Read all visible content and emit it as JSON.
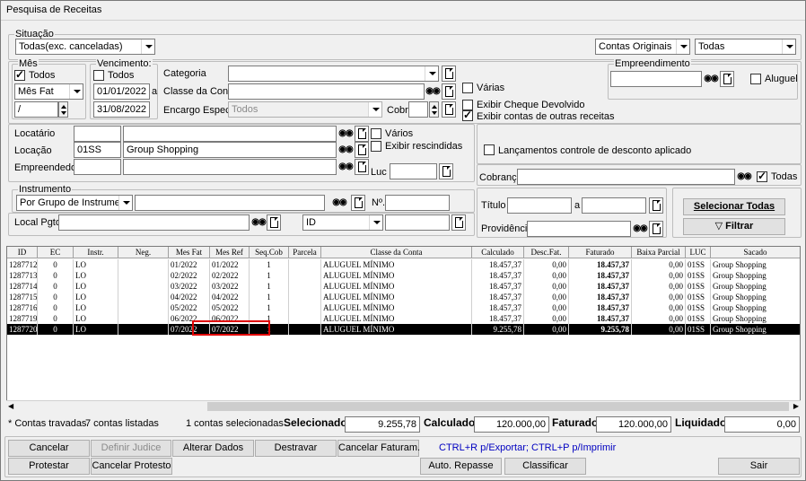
{
  "window": {
    "title": "Pesquisa de Receitas"
  },
  "situacao": {
    "label": "Situação",
    "value": "Todas(exc. canceladas)"
  },
  "top_right": {
    "contas": "Contas Originais",
    "todas": "Todas"
  },
  "mes": {
    "label": "Mês",
    "todos": "Todos",
    "todos_checked": true,
    "tipo": "Mês Fat",
    "valor": "/"
  },
  "vencimento": {
    "label": "Vencimento:",
    "todos": "Todos",
    "todos_checked": false,
    "de": "01/01/2022",
    "a_label": "a",
    "ate": "31/08/2022"
  },
  "categoria": {
    "label": "Categoria",
    "value": ""
  },
  "classe_conta": {
    "label": "Classe da Conta",
    "value": ""
  },
  "encargo": {
    "label": "Encargo Espec.",
    "value": "Todos"
  },
  "cobr": {
    "label": "Cobr",
    "value": ""
  },
  "options": {
    "varias": "Várias",
    "varias_checked": false,
    "cheque": "Exibir Cheque Devolvido",
    "cheque_checked": false,
    "outras": "Exibir contas de outras receitas",
    "outras_checked": true
  },
  "empreendimento": {
    "label": "Empreendimento",
    "value": "",
    "aluguel": "Aluguel",
    "aluguel_checked": false
  },
  "locatario": {
    "label": "Locatário",
    "code": "",
    "name": ""
  },
  "locacao": {
    "label": "Locação",
    "code": "01SS",
    "name": "Group Shopping"
  },
  "empreendedor": {
    "label": "Empreendedor",
    "code": "",
    "name": ""
  },
  "flags": {
    "varios": "Vários",
    "rescindidas": "Exibir rescindidas"
  },
  "luc": {
    "label": "Luc",
    "value": ""
  },
  "desconto": {
    "label": "Lançamentos controle de desconto aplicado",
    "checked": false
  },
  "cobranca": {
    "label": "Cobrança",
    "value": "",
    "todas": "Todas",
    "todas_checked": true
  },
  "instrumento": {
    "label": "Instrumento",
    "tipo": "Por Grupo de Instrumento",
    "value": "",
    "n_label": "Nº.",
    "n_value": ""
  },
  "local_pgto": {
    "label": "Local Pgto",
    "value": "",
    "id": "ID",
    "id_value": ""
  },
  "titulo": {
    "label": "Título",
    "de": "",
    "a_label": "a",
    "ate": ""
  },
  "providencia": {
    "label": "Providência",
    "value": ""
  },
  "buttons_right": {
    "selecionar": "Selecionar Todas",
    "filtrar": "Filtrar"
  },
  "grid": {
    "headers": [
      "ID",
      "EC",
      "Instr.",
      "Neg.",
      "Mes Fat",
      "Mes Ref",
      "Seq.Cob",
      "Parcela",
      "Classe da Conta",
      "Calculado",
      "Desc.Fat.",
      "Faturado",
      "Baixa Parcial",
      "LUC",
      "Sacado"
    ],
    "rows": [
      [
        "1287712",
        "0",
        "LO",
        "",
        "01/2022",
        "01/2022",
        "1",
        "",
        "ALUGUEL MÍNIMO",
        "18.457,37",
        "0,00",
        "18.457,37",
        "0,00",
        "01SS",
        "Group Shopping"
      ],
      [
        "1287713",
        "0",
        "LO",
        "",
        "02/2022",
        "02/2022",
        "1",
        "",
        "ALUGUEL MÍNIMO",
        "18.457,37",
        "0,00",
        "18.457,37",
        "0,00",
        "01SS",
        "Group Shopping"
      ],
      [
        "1287714",
        "0",
        "LO",
        "",
        "03/2022",
        "03/2022",
        "1",
        "",
        "ALUGUEL MÍNIMO",
        "18.457,37",
        "0,00",
        "18.457,37",
        "0,00",
        "01SS",
        "Group Shopping"
      ],
      [
        "1287715",
        "0",
        "LO",
        "",
        "04/2022",
        "04/2022",
        "1",
        "",
        "ALUGUEL MÍNIMO",
        "18.457,37",
        "0,00",
        "18.457,37",
        "0,00",
        "01SS",
        "Group Shopping"
      ],
      [
        "1287716",
        "0",
        "LO",
        "",
        "05/2022",
        "05/2022",
        "1",
        "",
        "ALUGUEL MÍNIMO",
        "18.457,37",
        "0,00",
        "18.457,37",
        "0,00",
        "01SS",
        "Group Shopping"
      ],
      [
        "1287719",
        "0",
        "LO",
        "",
        "06/2022",
        "06/2022",
        "1",
        "",
        "ALUGUEL MÍNIMO",
        "18.457,37",
        "0,00",
        "18.457,37",
        "0,00",
        "01SS",
        "Group Shopping"
      ],
      [
        "1287720",
        "0",
        "LO",
        "",
        "07/2022",
        "07/2022",
        "1",
        "",
        "ALUGUEL MÍNIMO",
        "9.255,78",
        "0,00",
        "9.255,78",
        "0,00",
        "01SS",
        "Group Shopping"
      ]
    ]
  },
  "status": {
    "travadas": "* Contas travadas",
    "listadas": "7 contas listadas",
    "selecionadas": "1 contas selecionadas"
  },
  "totals": {
    "selecionado_label": "Selecionado",
    "selecionado": "9.255,78",
    "calculado_label": "Calculado",
    "calculado": "120.000,00",
    "faturado_label": "Faturado",
    "faturado": "120.000,00",
    "liquidado_label": "Liquidado",
    "liquidado": "0,00"
  },
  "actions": {
    "cancelar": "Cancelar",
    "definir_judice": "Definir Judice",
    "alterar_dados": "Alterar Dados",
    "destravar": "Destravar",
    "cancelar_faturam": "Cancelar Faturam.",
    "hint": "CTRL+R p/Exportar; CTRL+P p/Imprimir",
    "protestar": "Protestar",
    "cancelar_protesto": "Cancelar Protesto",
    "auto_repasse": "Auto. Repasse",
    "classificar": "Classificar",
    "sair": "Sair"
  },
  "colors": {
    "highlight_row": "#000000",
    "annotation_box": "#e00000",
    "hint_text": "#0000c0"
  }
}
